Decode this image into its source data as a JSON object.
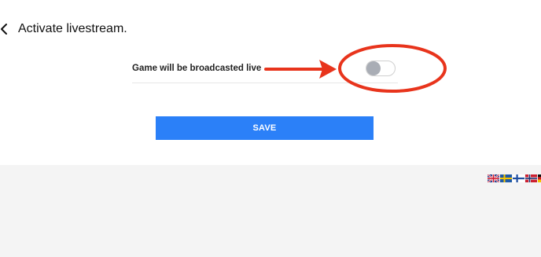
{
  "header": {
    "title": "Activate livestream.",
    "back_icon": "chevron-left-icon"
  },
  "setting": {
    "label": "Game will be broadcasted live",
    "toggle_state": "off"
  },
  "annotation": {
    "color": "#e8341c",
    "shapes": [
      "arrow",
      "ellipse"
    ]
  },
  "actions": {
    "save_label": "SAVE",
    "save_color": "#2b80f8"
  },
  "footer": {
    "languages": [
      "en",
      "sv",
      "fi",
      "no",
      "de"
    ],
    "background": "#f4f4f4"
  }
}
